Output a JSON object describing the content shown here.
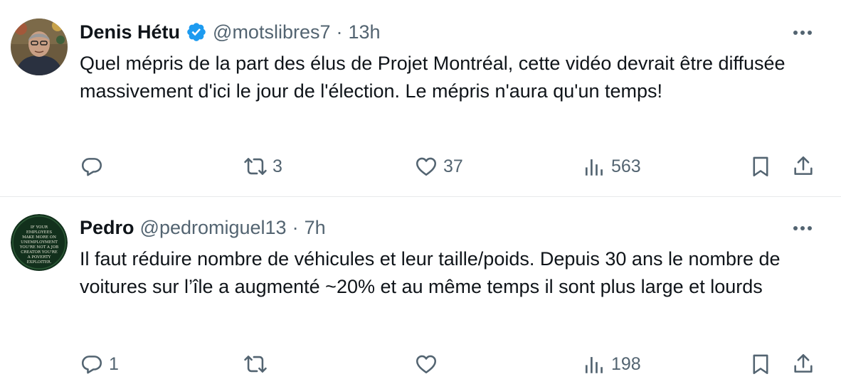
{
  "tweets": [
    {
      "author_name": "Denis Hétu",
      "verified": true,
      "handle": "@motslibres7",
      "separator": "·",
      "time": "13h",
      "text": "Quel mépris de la part des élus de Projet Montréal, cette vidéo devrait être diffusée massivement d'ici le jour de l'élection. Le mépris n'aura qu'un temps!",
      "reply_count": "",
      "retweet_count": "3",
      "like_count": "37",
      "view_count": "563",
      "avatar_icon": "photo-avatar"
    },
    {
      "author_name": "Pedro",
      "verified": false,
      "handle": "@pedromiguel13",
      "separator": "·",
      "time": "7h",
      "text": "Il faut réduire nombre de véhicules et leur taille/poids. Depuis 30 ans le nombre de voitures sur l’île a augmenté ~20% et au même temps il sont plus large et lourds",
      "reply_count": "1",
      "retweet_count": "",
      "like_count": "",
      "view_count": "198",
      "avatar_text": "IF YOUR EMPLOYEES MAKE MORE ON UNEMPLOYMENT YOU'RE NOT A JOB CREATOR YOU'RE A POVERTY EXPLOITER."
    }
  ],
  "colors": {
    "text": "#0f1419",
    "muted": "#536471",
    "verified": "#1d9bf0",
    "divider": "#e7e9ea"
  }
}
